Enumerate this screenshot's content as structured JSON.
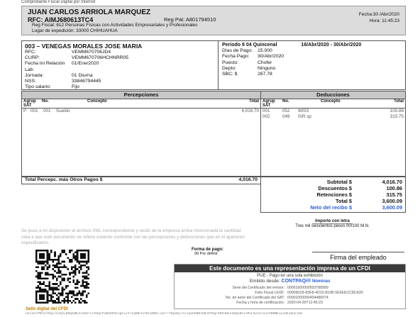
{
  "top_note": "Comprobante Fiscal Digital por Internet",
  "header": {
    "name": "JUAN CARLOS ARRIOLA MARQUEZ",
    "rfc": "RFC:  AIMJ680613TC4",
    "reg_pat": "Reg Pat:  A801794510",
    "reg_fiscal": "Reg Fiscal:               612 Personas Físicas con Actividades Empresariales y Profesionales",
    "lugar": "Lugar de expedición: 33000 CHIHUAHUA",
    "fecha": "Fecha:30 /Abr/2020",
    "hora": "Hora:  11:45:23"
  },
  "employee": {
    "title": "003 – VENEGAS MORALES JOSE MARIA",
    "fields": [
      {
        "k": "RFC:",
        "v": "VEMM670706JD4"
      },
      {
        "k": "CURP:",
        "v": "VEMM670706HCHNRR05"
      },
      {
        "k": "Fecha Ini Relación Lab:",
        "v": "01/Ene/2020"
      },
      {
        "k": "Jornada:",
        "v": "01 Diurna"
      },
      {
        "k": "NSS:",
        "v": "33846794445"
      },
      {
        "k": "Tipo salario:",
        "v": "Fijo"
      }
    ],
    "periodo_label": "Periodo 8 04 Quincenal",
    "periodo_range": "16/Abr/2020 - 30/Abr/2020",
    "right_fields": [
      {
        "k": "Días de Pago:",
        "v": "15.000"
      },
      {
        "k": "Fecha Pago:",
        "v": "30/Abr/2020"
      },
      {
        "k": "Puesto:",
        "v": "Chofer"
      },
      {
        "k": "Depto:",
        "v": "Ninguno"
      },
      {
        "k": "SBC:  $",
        "v": "267.78"
      }
    ]
  },
  "percepciones": {
    "title": "Percepciones",
    "headers": {
      "agrup": "Agrup",
      "sat": "SAT",
      "no": "No.",
      "concepto": "Concepto",
      "total": "Total"
    },
    "rows": [
      {
        "tipo": "P",
        "sat": "001",
        "no": "001",
        "concepto": "Sueldo",
        "total": "4,016.70"
      }
    ],
    "total_label": "Total Percepc. más Otros Pagos $",
    "total_value": "4,016.70"
  },
  "deducciones": {
    "title": "Deducciones",
    "headers": {
      "agrup": "Agrup",
      "sat": "SAT",
      "no": "No.",
      "concepto": "Concepto",
      "total": "Total"
    },
    "rows": [
      {
        "sat": "001",
        "no": "052",
        "concepto": "IMSS",
        "total": "100.86"
      },
      {
        "sat": "002",
        "no": "049",
        "concepto": "ISR sp",
        "total": "315.75"
      }
    ]
  },
  "summary": [
    {
      "k": "Subtotal $",
      "v": "4,016.70",
      "blue": false
    },
    {
      "k": "Descuentos $",
      "v": "100.86",
      "blue": false
    },
    {
      "k": "Retenciones $",
      "v": "315.75",
      "blue": false
    },
    {
      "k": "Total $",
      "v": "3,600.09",
      "blue": false
    },
    {
      "k": "Neto del recibo $",
      "v": "3,600.09",
      "blue": true
    }
  ],
  "importe": {
    "title": "Importe con letra",
    "text": "Tres mil seiscientos pesos 00/100 M.N."
  },
  "disclaimer": "Se puso a mi disposición el archivo XML correspondiente y recibí de la empresa arriba mencionada la cantidad neta a que este documento se refiere estando conforme con las percepciones y deducciones que en él aparecen especificados.",
  "forma_pago": {
    "label": "Forma de pago:",
    "value": "99  Por definir"
  },
  "firma": "Firma del empleado",
  "representacion": {
    "title": "Este documento es una representación impresa de un CFDI",
    "pue": "PUE - Pago en una sola exhibición",
    "emitido_prefix": "Emitido desde:",
    "brand": "CONTPAQi®",
    "brand_sub": "Nóminas",
    "cert_rows": [
      {
        "k": "Serie del Certificado del emisor:",
        "v": "00001000000503788999"
      },
      {
        "k": "Folio Fiscal UUID:",
        "v": "0000901B-82E8-4D15-816B-5E5EECC8CA30"
      },
      {
        "k": "No. de serie del Certificado del SAT:",
        "v": "00001000000404486074"
      },
      {
        "k": "Fecha y hora de certificación:",
        "v": "2020-04-30T12:45:23"
      }
    ]
  },
  "sello_label": "Sello digital del CFDI",
  "sello_text": "uxcxFCP9cSrVSp/z1dyn3HOyGWC5vSmzTCFhmq+P2BSRPd1vglLvYTzyBB/O/Dn2dHbilax++rKpwmj/sciq1HSBB+bB7Rf6q/A8938EFe0qx8S1iM1FRZ1e7uuiPB6Wk1Z2d61dux1SB"
}
